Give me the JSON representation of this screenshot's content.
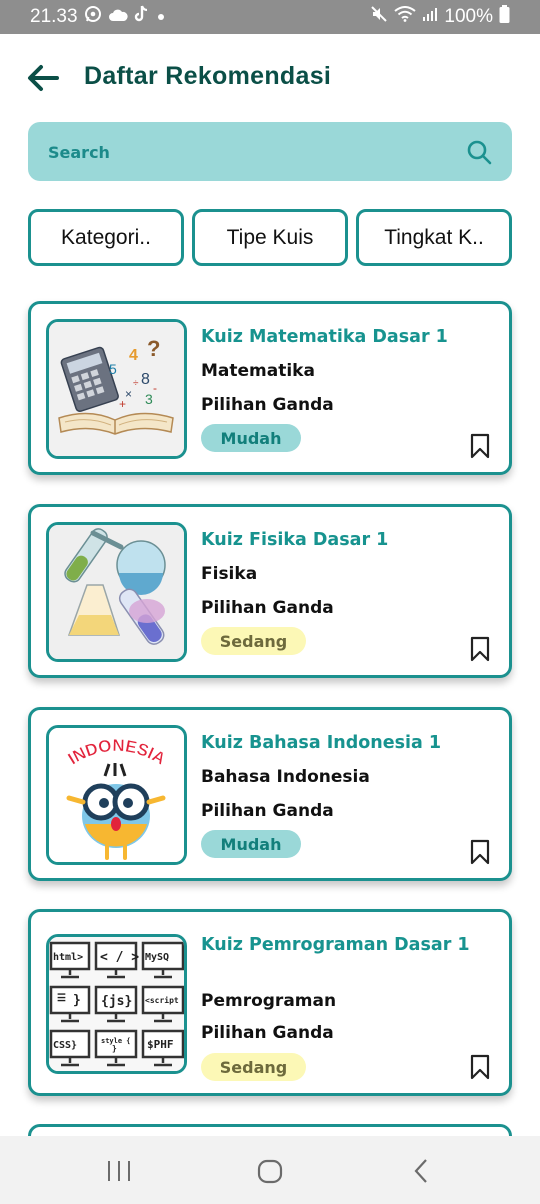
{
  "status_bar": {
    "time": "21.33",
    "battery": "100%"
  },
  "header": {
    "title": "Daftar Rekomendasi"
  },
  "search": {
    "placeholder": "Search"
  },
  "filters": [
    {
      "label": "Kategori.."
    },
    {
      "label": "Tipe Kuis"
    },
    {
      "label": "Tingkat K.."
    }
  ],
  "quizzes": [
    {
      "title": "Kuiz Matematika Dasar 1",
      "category": "Matematika",
      "type": "Pilihan Ganda",
      "level": "Mudah",
      "image": "math-illustration"
    },
    {
      "title": "Kuiz Fisika Dasar 1",
      "category": "Fisika",
      "type": "Pilihan Ganda",
      "level": "Sedang",
      "image": "physics-illustration"
    },
    {
      "title": "Kuiz Bahasa Indonesia 1",
      "category": "Bahasa Indonesia",
      "type": "Pilihan Ganda",
      "level": "Mudah",
      "image": "indonesia-illustration",
      "image_text": "INDONESIA"
    },
    {
      "title": "Kuiz Pemrograman Dasar 1",
      "category": "Pemrograman",
      "type": "Pilihan Ganda",
      "level": "Sedang",
      "image": "programming-illustration",
      "image_labels": [
        "html>",
        "< / >",
        "MySQ",
        "{js}",
        "<script",
        "CSS}",
        "style {",
        "$PHF"
      ]
    }
  ],
  "colors": {
    "primary": "#1b918f",
    "title": "#0b4f47",
    "search_bg": "#9ad8d8",
    "easy_bg": "#9ad8d8",
    "medium_bg": "#fcf8b6"
  }
}
